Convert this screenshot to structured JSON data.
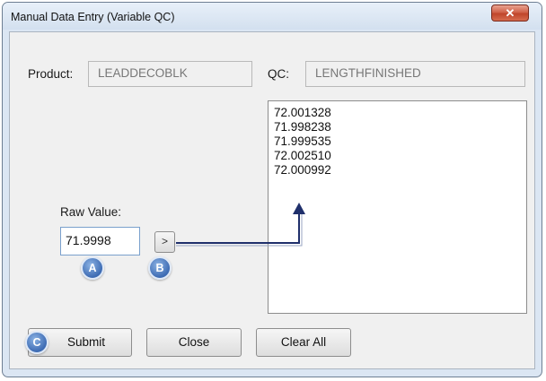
{
  "window": {
    "title": "Manual Data Entry (Variable QC)",
    "close_glyph": "✕"
  },
  "product": {
    "label": "Product:",
    "value": "LEADDECOBLK"
  },
  "qc": {
    "label": "QC:",
    "value": "LENGTHFINISHED"
  },
  "raw_value": {
    "label": "Raw Value:",
    "value": "71.9998"
  },
  "add_button": {
    "glyph": ">"
  },
  "values_list": [
    "72.001328",
    "71.998238",
    "71.999535",
    "72.002510",
    "72.000992"
  ],
  "buttons": {
    "submit": "Submit",
    "close": "Close",
    "clear_all": "Clear All"
  },
  "callouts": {
    "a": "A",
    "b": "B",
    "c": "C"
  },
  "colors": {
    "arrow": "#1f2f6b",
    "badge": "#3d6bb3",
    "close_button": "#c0452a"
  }
}
